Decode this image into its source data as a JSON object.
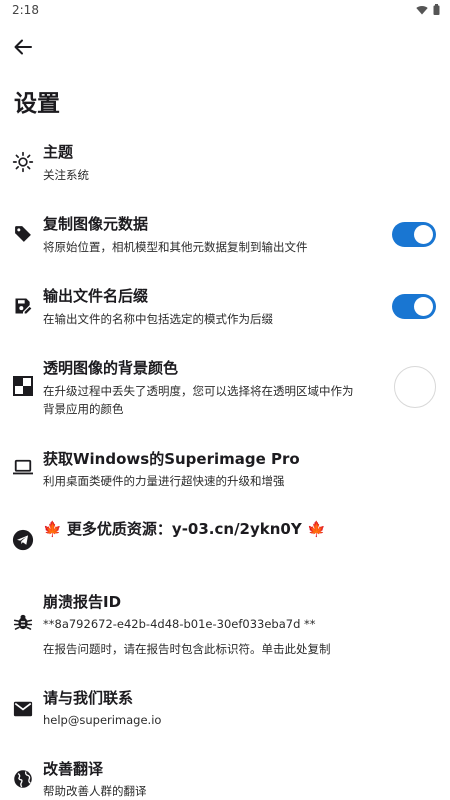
{
  "status_bar": {
    "time": "2:18"
  },
  "page": {
    "title": "设置"
  },
  "settings": {
    "theme": {
      "title": "主题",
      "subtitle": "关注系统"
    },
    "copy_metadata": {
      "title": "复制图像元数据",
      "subtitle": "将原始位置，相机模型和其他元数据复制到输出文件",
      "enabled": true
    },
    "filename_suffix": {
      "title": "输出文件名后缀",
      "subtitle": "在输出文件的名称中包括选定的模式作为后缀",
      "enabled": true
    },
    "transparent_bg": {
      "title": "透明图像的背景颜色",
      "subtitle_line1": "在升级过程中丢失了透明度，您可以选择将在透明区域中作为",
      "subtitle_line2": "背景应用的颜色",
      "color": "#ffffff"
    },
    "windows_pro": {
      "title": "获取Windows的Superimage Pro",
      "subtitle": "利用桌面类硬件的力量进行超快速的升级和增强"
    },
    "resources": {
      "leaf_left": "🍁",
      "title": "更多优质资源：y-03.cn/2ykn0Y",
      "leaf_right": "🍁"
    },
    "crash_id": {
      "title": "崩溃报告ID",
      "id": "**8a792672-e42b-4d48-b01e-30ef033eba7d **",
      "note": "在报告问题时，请在报告时包含此标识符。单击此处复制"
    },
    "contact": {
      "title": "请与我们联系",
      "email": "help@superimage.io"
    },
    "translate": {
      "title": "改善翻译",
      "subtitle": "帮助改善人群的翻译"
    }
  },
  "colors": {
    "accent": "#1976d2",
    "text": "#1c1b1f",
    "leaf": "#e08a1e"
  }
}
